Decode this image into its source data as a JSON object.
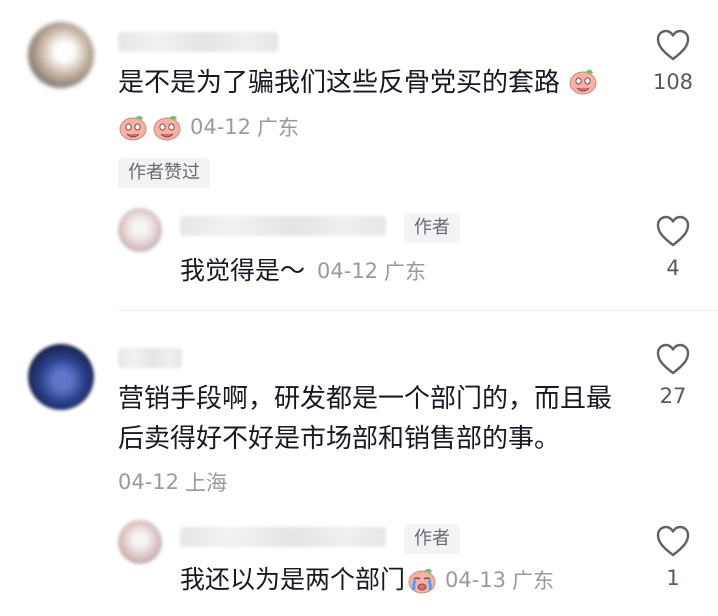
{
  "comments": [
    {
      "text": "是不是为了骗我们这些反骨党买的套路",
      "date": "04-12",
      "location": "广东",
      "badge": "作者赞过",
      "likes": "108",
      "reply": {
        "author_tag": "作者",
        "text": "我觉得是～",
        "date": "04-12",
        "location": "广东",
        "likes": "4"
      }
    },
    {
      "text_line1": "营销手段啊，研发都是一个部门的，而且最",
      "text_line2": "后卖得好不好是市场部和销售部的事。",
      "date": "04-12",
      "location": "上海",
      "likes": "27",
      "reply": {
        "author_tag": "作者",
        "text": "我还以为是两个部门",
        "date": "04-13",
        "location": "广东",
        "likes": "1"
      }
    }
  ],
  "icons": {
    "like": "heart-outline-icon",
    "emoji_peach": "peach-face-emoji",
    "emoji_cry": "crying-face-emoji"
  },
  "colors": {
    "text": "#161823",
    "meta": "#9a9a9a",
    "tag_bg": "#f3f3f5",
    "divider": "#ededed"
  }
}
